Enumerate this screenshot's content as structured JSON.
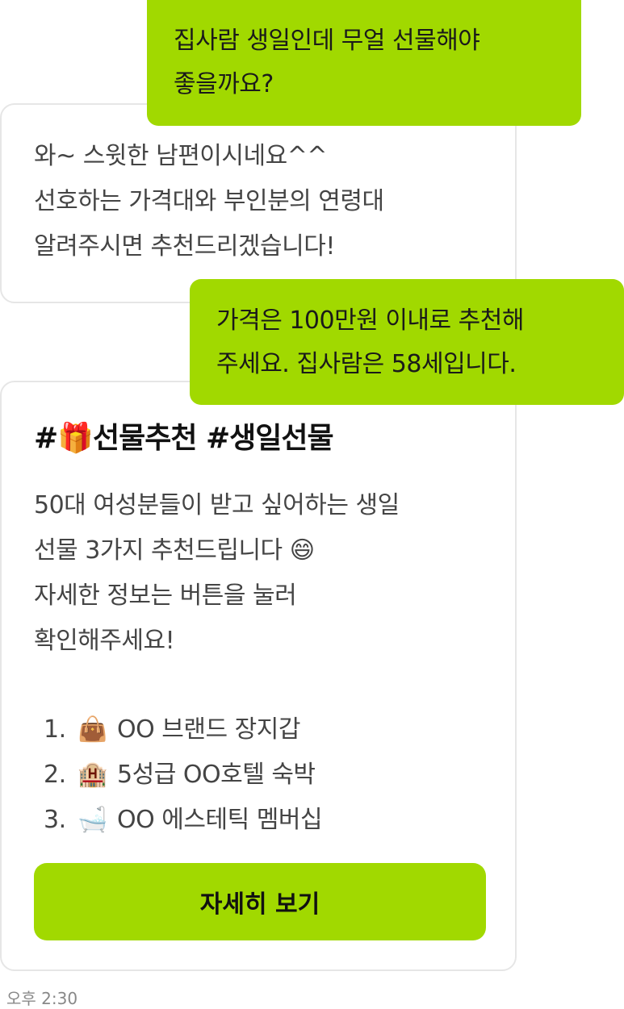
{
  "messages": [
    {
      "sender": "user",
      "lines": [
        "집사람 생일인데 무얼 선물해야",
        "좋을까요?"
      ]
    },
    {
      "sender": "bot",
      "lines": [
        "와~ 스윗한 남편이시네요^^",
        "선호하는 가격대와 부인분의 연령대",
        "알려주시면 추천드리겠습니다!"
      ]
    },
    {
      "sender": "user",
      "lines": [
        "가격은 100만원 이내로 추천해",
        "주세요. 집사람은 58세입니다."
      ]
    },
    {
      "sender": "bot",
      "card": {
        "title": "#🎁선물추천 #생일선물",
        "body_lines": [
          "50대 여성분들이 받고 싶어하는 생일",
          "선물 3가지 추천드립니다 😄",
          "자세한 정보는 버튼을 눌러",
          "확인해주세요!"
        ],
        "items": [
          {
            "num": "1.",
            "emoji": "👜",
            "text": "OO 브랜드 장지갑"
          },
          {
            "num": "2.",
            "emoji": "🏨",
            "text": "5성급 OO호텔 숙박"
          },
          {
            "num": "3.",
            "emoji": "🛁",
            "text": "OO 에스테틱 멤버십"
          }
        ],
        "button_label": "자세히 보기"
      }
    }
  ],
  "timestamp": "오후 2:30",
  "colors": {
    "user_bubble": "#a1d900",
    "bot_border": "#e6e6e6",
    "button": "#a1d900"
  }
}
